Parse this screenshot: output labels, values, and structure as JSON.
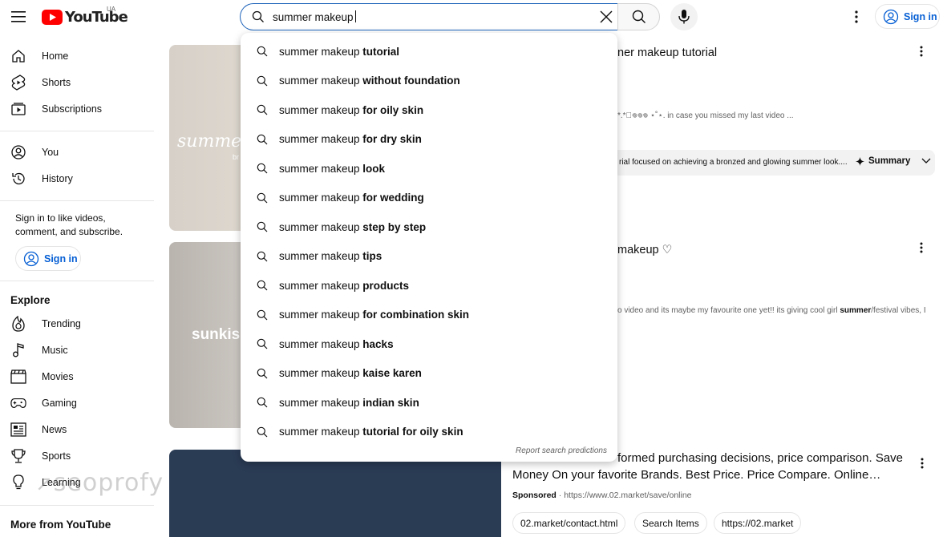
{
  "header": {
    "logo_text": "YouTube",
    "logo_region": "UA",
    "search_value": "summer makeup",
    "signin_label": "Sign in"
  },
  "sidebar": {
    "items": [
      {
        "label": "Home",
        "icon": "home-icon"
      },
      {
        "label": "Shorts",
        "icon": "shorts-icon"
      },
      {
        "label": "Subscriptions",
        "icon": "subscriptions-icon"
      },
      {
        "label": "You",
        "icon": "you-icon"
      },
      {
        "label": "History",
        "icon": "history-icon"
      }
    ],
    "signin_prompt": "Sign in to like videos, comment, and subscribe.",
    "signin_label": "Sign in",
    "explore_title": "Explore",
    "explore": [
      {
        "label": "Trending",
        "icon": "trending-icon"
      },
      {
        "label": "Music",
        "icon": "music-icon"
      },
      {
        "label": "Movies",
        "icon": "movies-icon"
      },
      {
        "label": "Gaming",
        "icon": "gaming-icon"
      },
      {
        "label": "News",
        "icon": "news-icon"
      },
      {
        "label": "Sports",
        "icon": "sports-icon"
      },
      {
        "label": "Learning",
        "icon": "learning-icon"
      }
    ],
    "more_title": "More from YouTube",
    "watermark": "seoprofy"
  },
  "suggestions": {
    "prefix": "summer makeup ",
    "items": [
      "tutorial",
      "without foundation",
      "for oily skin",
      "for dry skin",
      "look",
      "for wedding",
      "step by step",
      "tips",
      "products",
      "for combination skin",
      "hacks",
      "kaise karen",
      "indian skin",
      "tutorial for oily skin"
    ],
    "report_label": "Report search predictions"
  },
  "results": {
    "r1": {
      "title_fragment": "ner makeup tutorial",
      "thumb_text": "summe",
      "thumb_subtext": "br",
      "desc_fragment": "*.*ﾟ𖦹𖦹𖦹 ⋆˚⋆. in case you missed my last video ...",
      "summary_text": "rial focused on achieving a bronzed and glowing summer look....",
      "summary_label": "Summary"
    },
    "r2": {
      "title_fragment": "makeup ♡",
      "thumb_text": "sunkiss",
      "desc_pre": "o video and its maybe my favourite one yet!! its giving cool girl ",
      "desc_bold": "summer",
      "desc_post": "/festival vibes, I"
    },
    "ad": {
      "title": "formed purchasing decisions, price comparison. Save Money On your favorite Brands. Best Price. Price Compare. Online…",
      "sponsored_label": "Sponsored",
      "url": "https://www.02.market/save/online",
      "chips": [
        "02.market/contact.html",
        "Search Items",
        "https://02.market"
      ]
    }
  },
  "colors": {
    "brand_red": "#ff0000",
    "link_blue": "#065fd4",
    "focus_blue": "#1c62b9"
  }
}
